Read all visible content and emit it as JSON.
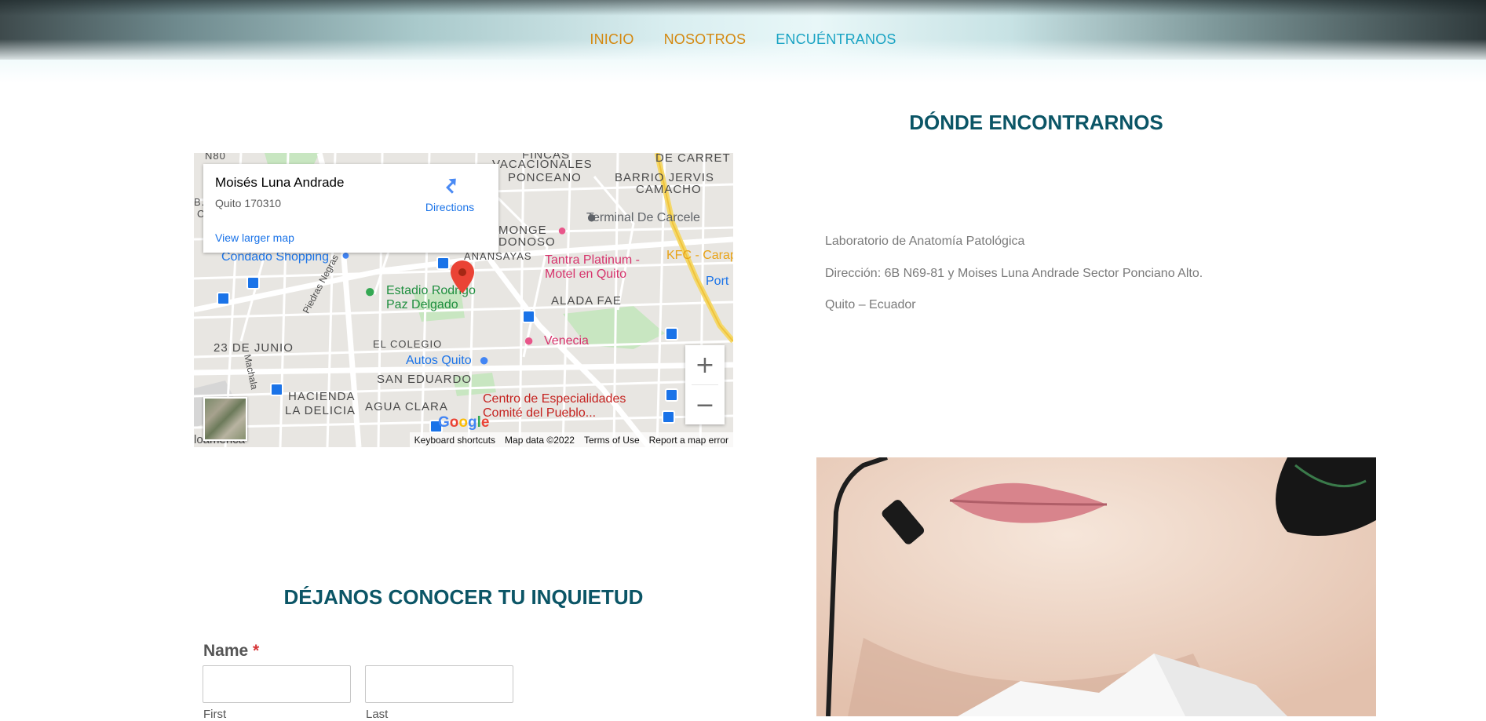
{
  "nav": {
    "items": [
      "INICIO",
      "NOSOTROS",
      "ENCUÉNTRANOS"
    ],
    "active_index": 2,
    "colors": {
      "default": "#d4880f",
      "active": "#19a3c3"
    }
  },
  "map": {
    "info_card": {
      "title": "Moisés Luna Andrade",
      "address": "Quito 170310",
      "directions_label": "Directions",
      "view_larger_label": "View larger map"
    },
    "labels": {
      "n80": "N80",
      "fincas": "FINCAS",
      "vacacionales": "VACACIONALES",
      "ponceano": "PONCEANO",
      "de_carret": "DE CARRET",
      "barrio_jervis": "BARRIO JERVIS",
      "camacho": "CAMACHO",
      "monge": "MONGE",
      "donoso": "DONOSO",
      "anansayas": "ANANSAYAS",
      "alada_fae": "ALADA FAE",
      "el_colegio": "EL COLEGIO",
      "junio": "23 DE JUNIO",
      "san_eduardo": "SAN EDUARDO",
      "hacienda": "HACIENDA",
      "la_delicia": "LA DELICIA",
      "agua_clara": "AGUA CLARA",
      "piedras_negras": "Piedras Negras",
      "machala": "Machala",
      "loamerica": "loamérica",
      "b": "B.",
      "c": "C"
    },
    "pois": {
      "terminal": "Terminal De Carcele",
      "tantra_1": "Tantra Platinum -",
      "tantra_2": "Motel en Quito",
      "kfc": "KFC - Carap",
      "porta": "Port",
      "condado": "Condado Shopping",
      "estadio_1": "Estadio Rodrigo",
      "estadio_2": "Paz Delgado",
      "venecia": "Venecia",
      "autos": "Autos Quito",
      "centro_1": "Centro de Especialidades",
      "centro_2": "Comité del Pueblo..."
    },
    "google_logo": "Google",
    "zoom_in": "+",
    "zoom_out": "−",
    "footer": {
      "shortcuts": "Keyboard shortcuts",
      "map_data": "Map data ©2022",
      "terms": "Terms of Use",
      "report": "Report a map error"
    }
  },
  "location": {
    "title": "DÓNDE ENCONTRARNOS",
    "lines": [
      "Laboratorio de Anatomía Patológica",
      "Dirección: 6B N69-81 y Moises Luna Andrade Sector Ponciano Alto.",
      "Quito – Ecuador"
    ]
  },
  "form": {
    "title": "DÉJANOS CONOCER TU INQUIETUD",
    "name_label": "Name",
    "required_mark": "*",
    "first_label": "First",
    "last_label": "Last",
    "first_value": "",
    "last_value": ""
  }
}
